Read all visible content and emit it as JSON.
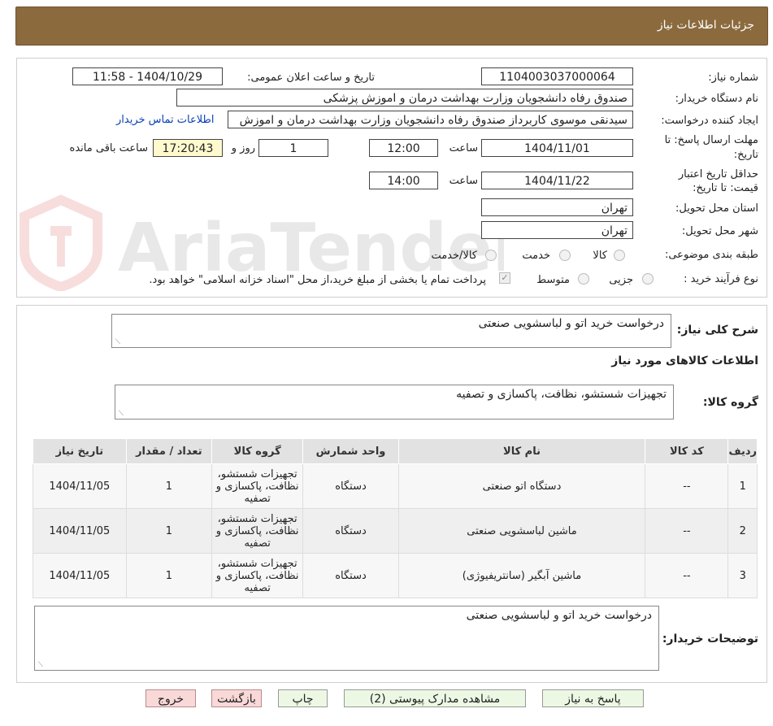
{
  "header": {
    "title": "جزئیات اطلاعات نیاز"
  },
  "form": {
    "need_number_label": "شماره نیاز:",
    "need_number": "1104003037000064",
    "announce_label": "تاریخ و ساعت اعلان عمومی:",
    "announce_value": "1404/10/29 - 11:58",
    "buyer_org_label": "نام دستگاه خریدار:",
    "buyer_org": "صندوق رفاه دانشجویان وزارت بهداشت  درمان و اموزش پزشکی",
    "creator_label": "ایجاد کننده درخواست:",
    "creator": "سیدنقی موسوی کاربرداز صندوق رفاه دانشجویان وزارت بهداشت  درمان و اموزش",
    "contact_link": "اطلاعات تماس خریدار",
    "deadline_label_1": "مهلت ارسال پاسخ: تا",
    "deadline_label_2": "تاریخ:",
    "deadline_date": "1404/11/01",
    "time_label": "ساعت",
    "deadline_time": "12:00",
    "days_value": "1",
    "days_label": "روز و",
    "remaining_time": "17:20:43",
    "remaining_label": "ساعت باقی مانده",
    "validity_label_1": "حداقل تاریخ اعتبار",
    "validity_label_2": "قیمت: تا تاریخ:",
    "validity_date": "1404/11/22",
    "validity_time": "14:00",
    "province_label": "استان محل تحویل:",
    "province": "تهران",
    "city_label": "شهر محل تحویل:",
    "city": "تهران",
    "category_label": "طبقه بندی موضوعی:",
    "category_options": [
      "کالا",
      "خدمت",
      "کالا/خدمت"
    ],
    "process_label": "نوع فرآیند خرید :",
    "process_options": [
      "جزیی",
      "متوسط"
    ],
    "payment_note": "پرداخت تمام یا بخشی از مبلغ خرید،از محل \"اسناد خزانه اسلامی\" خواهد بود."
  },
  "summary": {
    "desc_label": "شرح کلی نیاز:",
    "desc_value": "درخواست خرید اتو و لباسشویی صنعتی",
    "goods_info_title": "اطلاعات کالاهای مورد نیاز",
    "group_label": "گروه کالا:",
    "group_value": "تجهیزات شستشو، نظافت، پاکسازی و تصفیه"
  },
  "table": {
    "headers": [
      "ردیف",
      "کد کالا",
      "نام کالا",
      "واحد شمارش",
      "گروه کالا",
      "تعداد / مقدار",
      "تاریخ نیاز"
    ],
    "rows": [
      [
        "1",
        "--",
        "دستگاه اتو صنعتی",
        "دستگاه",
        "تجهیزات شستشو، نظافت، پاکسازی و تصفیه",
        "1",
        "1404/11/05"
      ],
      [
        "2",
        "--",
        "ماشین لباسشویی صنعتی",
        "دستگاه",
        "تجهیزات شستشو، نظافت، پاکسازی و تصفیه",
        "1",
        "1404/11/05"
      ],
      [
        "3",
        "--",
        "ماشین آبگیر (سانتریفیوژی)",
        "دستگاه",
        "تجهیزات شستشو، نظافت، پاکسازی و تصفیه",
        "1",
        "1404/11/05"
      ]
    ]
  },
  "buyer_notes": {
    "label": "توضیحات خریدار:",
    "value": "درخواست خرید اتو و لباسشویی صنعتی"
  },
  "buttons": {
    "reply": "پاسخ به نیاز",
    "attachments": "مشاهده مدارک پیوستی (2)",
    "print": "چاپ",
    "back": "بازگشت",
    "exit": "خروج"
  },
  "watermark": "AriaTender.neT",
  "colors": {
    "header": "#8b6a3e",
    "link": "#0b3fb3",
    "highlight": "#fffacd"
  }
}
